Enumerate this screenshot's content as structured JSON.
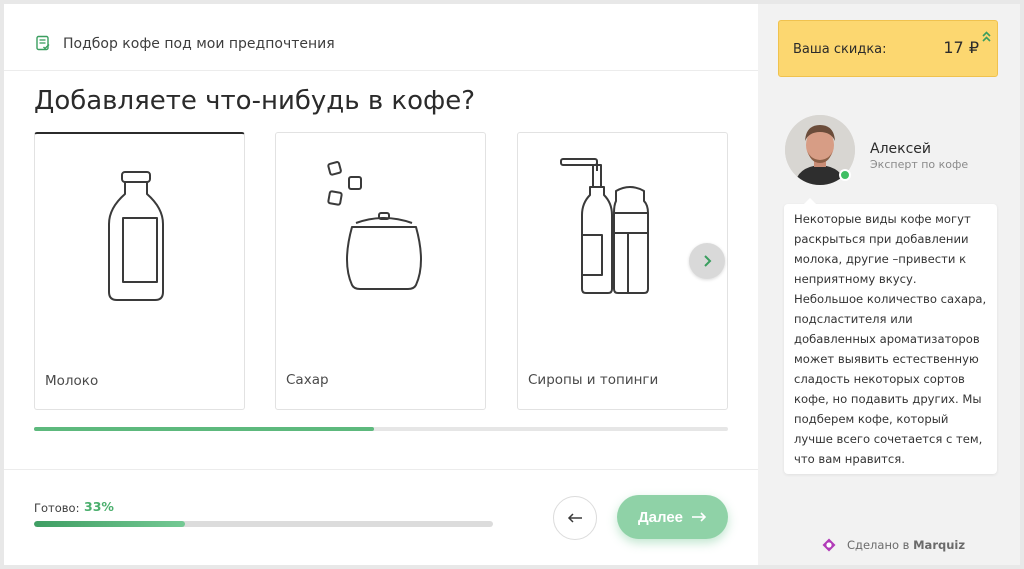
{
  "header": {
    "title": "Подбор кофе под мои предпочтения",
    "icon": "clipboard-check-icon"
  },
  "question": "Добавляете что-нибудь в кофе?",
  "options": [
    {
      "label": "Молоко",
      "icon": "milk-bottle-icon",
      "selected": true
    },
    {
      "label": "Сахар",
      "icon": "sugar-bowl-icon",
      "selected": false
    },
    {
      "label": "Сиропы и топинги",
      "icon": "syrup-bottles-icon",
      "selected": false
    }
  ],
  "carousel": {
    "scroll_fraction": 0.49
  },
  "progress": {
    "label": "Готово:",
    "value_text": "33%",
    "value": 33
  },
  "nav": {
    "back_icon": "arrow-left-icon",
    "next_label": "Далее",
    "next_icon": "arrow-right-icon"
  },
  "discount": {
    "label": "Ваша скидка:",
    "value": "17 ₽"
  },
  "expert": {
    "name": "Алексей",
    "role": "Эксперт по кофе",
    "message": "Некоторые виды кофе могут раскрыться при добавлении молока, другие –привести к неприятному вкусу. Небольшое количество сахара, подсластителя или добавленных ароматизаторов может выявить естественную сладость некоторых сортов кофе, но подавить других. Мы подберем кофе, который лучше всего сочетается с тем, что вам нравится."
  },
  "footer": {
    "made_by_prefix": "Сделано в",
    "made_by_brand": "Marquiz"
  },
  "colors": {
    "accent": "#5db97d",
    "button": "#8fd2a7",
    "discount_bg": "#fcd770",
    "online": "#3fbf63"
  }
}
